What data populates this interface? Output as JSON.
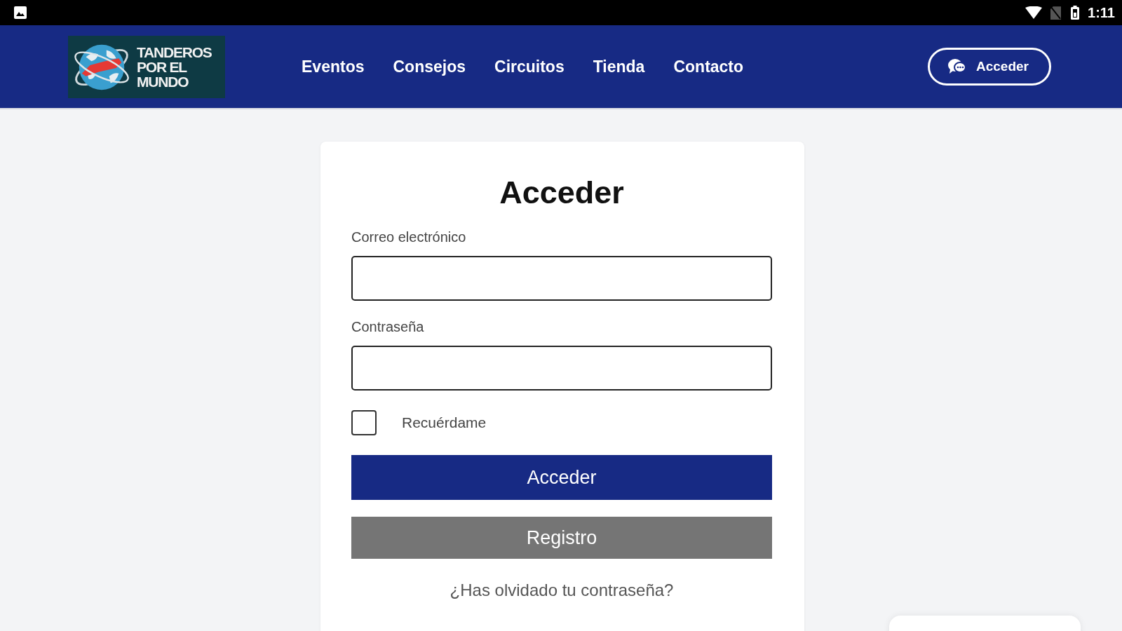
{
  "status_bar": {
    "time": "1:11"
  },
  "header": {
    "logo": {
      "lines": [
        "TANDEROS",
        "POR EL",
        "MUNDO"
      ]
    },
    "nav": [
      "Eventos",
      "Consejos",
      "Circuitos",
      "Tienda",
      "Contacto"
    ],
    "login_button": {
      "label": "Acceder"
    }
  },
  "form": {
    "title": "Acceder",
    "fields": [
      {
        "label": "Correo electrónico"
      },
      {
        "label": "Contraseña"
      }
    ],
    "remember": {
      "label": "Recuérdame",
      "checked": false
    },
    "buttons": [
      {
        "label": "Acceder",
        "kind": "primary"
      },
      {
        "label": "Registro",
        "kind": "secondary"
      }
    ],
    "forgot_link": "¿Has olvidado tu contraseña?"
  }
}
